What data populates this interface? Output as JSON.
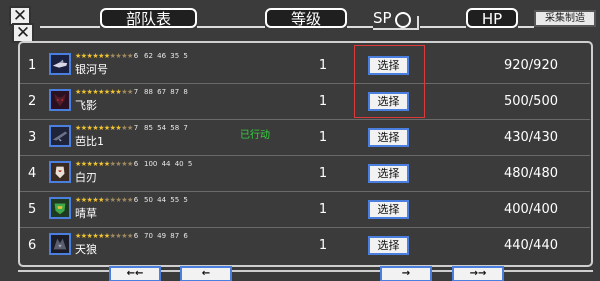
{
  "header": {
    "title": "部队表",
    "level_label": "等级",
    "sp_label": "SP",
    "hp_label": "HP",
    "craft_button": "采集制造"
  },
  "units": [
    {
      "index": "1",
      "stars": "★★★★★★",
      "dim_stars": "★★★★",
      "star_level": "6",
      "stats": "62 46 35 5",
      "name": "银河号",
      "status": "",
      "level": "1",
      "select_label": "选择",
      "hp": "920/920",
      "icon": "starship-icon"
    },
    {
      "index": "2",
      "stars": "★★★★★★★★",
      "dim_stars": "★★",
      "star_level": "7",
      "stats": "88 67 87 8",
      "name": "飞影",
      "status": "",
      "level": "1",
      "select_label": "选择",
      "hp": "500/500",
      "icon": "mecha-head-icon"
    },
    {
      "index": "3",
      "stars": "★★★★★★★★",
      "dim_stars": "★★",
      "star_level": "7",
      "stats": "85 54 58 7",
      "name": "芭比1",
      "status": "已行动",
      "level": "1",
      "select_label": "选择",
      "hp": "430/430",
      "icon": "jet-icon"
    },
    {
      "index": "4",
      "stars": "★★★★★★",
      "dim_stars": "★★★★",
      "star_level": "6",
      "stats": "100 44 40 5",
      "name": "白刃",
      "status": "",
      "level": "1",
      "select_label": "选择",
      "hp": "480/480",
      "icon": "white-mecha-icon"
    },
    {
      "index": "5",
      "stars": "★★★★★",
      "dim_stars": "★★★★★",
      "star_level": "6",
      "stats": "50 44 55 5",
      "name": "晴草",
      "status": "",
      "level": "1",
      "select_label": "选择",
      "hp": "400/400",
      "icon": "green-mecha-icon"
    },
    {
      "index": "6",
      "stars": "★★★★★★",
      "dim_stars": "★★★★",
      "star_level": "6",
      "stats": "70 49 87 6",
      "name": "天狼",
      "status": "",
      "level": "1",
      "select_label": "选择",
      "hp": "440/440",
      "icon": "wolf-mecha-icon"
    }
  ],
  "footer": {
    "first_label": "←←",
    "prev_label": "←",
    "next_label": "→",
    "last_label": "→→"
  },
  "colors": {
    "background": "#3b3b3b",
    "button_border": "#4a7fe0",
    "acted_status": "#34d23e",
    "star": "#f0c230",
    "highlight": "#d93b3b"
  }
}
